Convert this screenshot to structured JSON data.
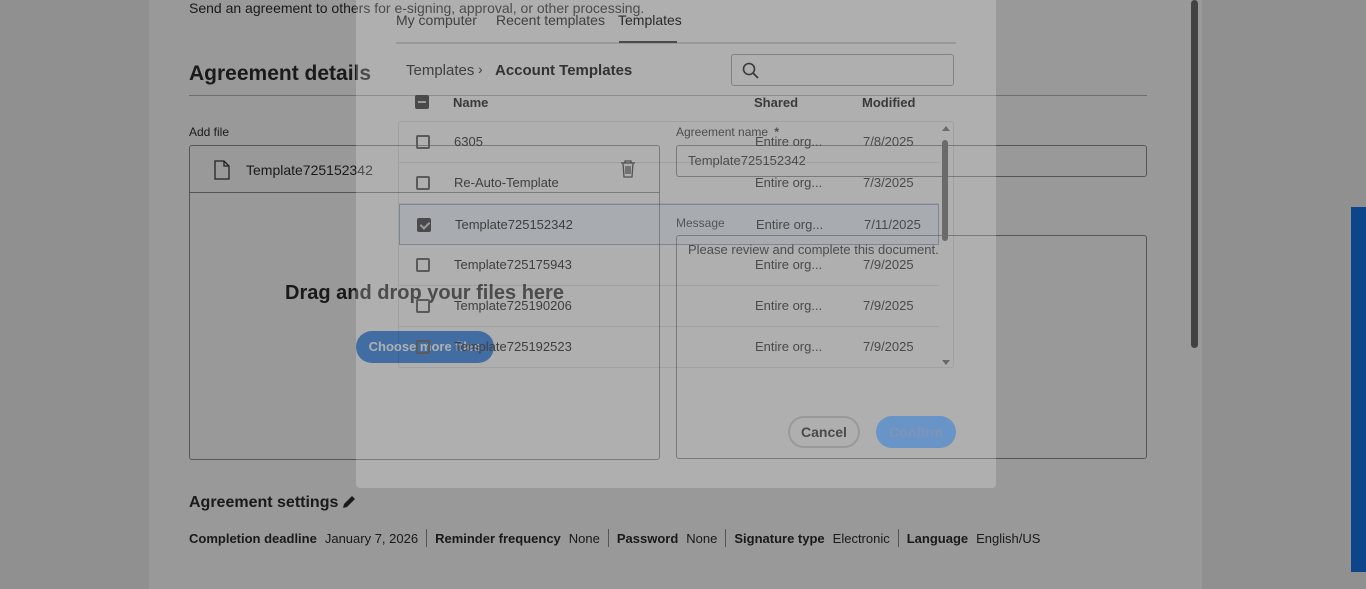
{
  "page": {
    "intro_text": "Send an agreement to others for e-signing, approval, or other processing.",
    "details_title": "Agreement details",
    "add_file_label": "Add file",
    "file_name": "Template725152342",
    "drop_text": "Drag and drop your files here",
    "choose_button": "Choose more files",
    "agreement_name_label": "Agreement name",
    "required_marker": "*",
    "agreement_name_value": "Template725152342",
    "message_label": "Message",
    "message_value": "Please review and complete this document.",
    "settings_title": "Agreement settings",
    "settings": [
      {
        "key": "Completion deadline",
        "value": "January 7, 2026"
      },
      {
        "key": "Reminder frequency",
        "value": "None"
      },
      {
        "key": "Password",
        "value": "None"
      },
      {
        "key": "Signature type",
        "value": "Electronic"
      },
      {
        "key": "Language",
        "value": "English/US"
      }
    ]
  },
  "modal": {
    "tabs": [
      {
        "label": "My computer",
        "active": false
      },
      {
        "label": "Recent templates",
        "active": false
      },
      {
        "label": "Templates",
        "active": true
      }
    ],
    "breadcrumb": {
      "root": "Templates",
      "separator": "›",
      "current": "Account Templates"
    },
    "search_placeholder": "",
    "columns": {
      "name": "Name",
      "shared": "Shared",
      "modified": "Modified"
    },
    "rows": [
      {
        "name": "6305",
        "shared": "Entire org...",
        "modified": "7/8/2025",
        "checked": false
      },
      {
        "name": "Re-Auto-Template",
        "shared": "Entire org...",
        "modified": "7/3/2025",
        "checked": false
      },
      {
        "name": "Template725152342",
        "shared": "Entire org...",
        "modified": "7/11/2025",
        "checked": true
      },
      {
        "name": "Template725175943",
        "shared": "Entire org...",
        "modified": "7/9/2025",
        "checked": false
      },
      {
        "name": "Template725190206",
        "shared": "Entire org...",
        "modified": "7/9/2025",
        "checked": false
      },
      {
        "name": "Template725192523",
        "shared": "Entire org...",
        "modified": "7/9/2025",
        "checked": false
      }
    ],
    "cancel_label": "Cancel",
    "confirm_label": "Confirm"
  },
  "colors": {
    "accent": "#1473e6",
    "overlay": "rgba(0,0,0,0.40)"
  },
  "icons": [
    "document-icon",
    "trash-icon",
    "pencil-icon",
    "search-icon",
    "checkbox-icon"
  ]
}
